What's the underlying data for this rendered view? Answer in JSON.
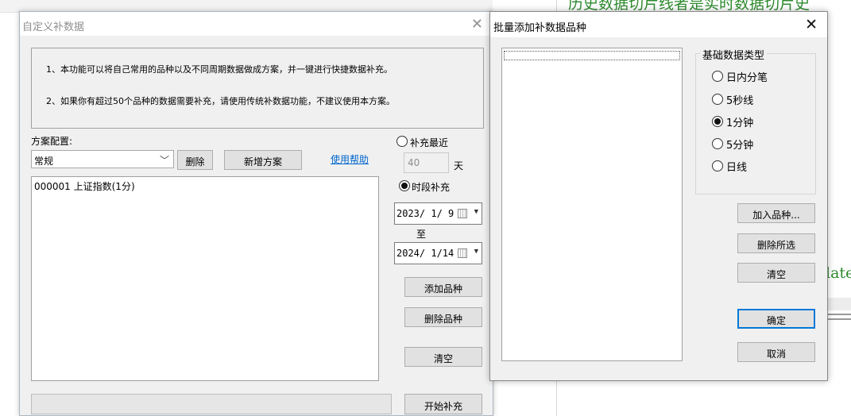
{
  "background": {
    "green_text_top": "历史数据切片线者是实时数据切片史",
    "green_text_mid": "late"
  },
  "dialog_custom": {
    "title": "自定义补数据",
    "info_line1": "1、本功能可以将自己常用的品种以及不同周期数据做成方案，并一键进行快捷数据补充。",
    "info_line2": "2、如果你有超过50个品种的数据需要补充，请使用传统补数据功能，不建议使用本方案。",
    "scheme_label": "方案配置:",
    "scheme_value": "常规",
    "delete_label": "删除",
    "new_scheme_label": "新增方案",
    "help_link": "使用帮助",
    "list_items": [
      "000001 上证指数(1分)"
    ],
    "recent_radio": "补充最近",
    "recent_days": "40",
    "days_unit": "天",
    "period_radio": "时段补充",
    "date_from": "2023/ 1/ 9",
    "date_to_label": "至",
    "date_to": "2024/ 1/14",
    "add_item": "添加品种",
    "delete_item": "删除品种",
    "clear": "清空",
    "start": "开始补充",
    "selected_mode": "period"
  },
  "dialog_batch": {
    "title": "批量添加补数据品种",
    "group_title": "基础数据类型",
    "options": [
      "日内分笔",
      "5秒线",
      "1分钟",
      "5分钟",
      "日线"
    ],
    "selected_option": "1分钟",
    "add_btn": "加入品种...",
    "delete_sel_btn": "删除所选",
    "clear_btn": "清空",
    "ok_btn": "确定",
    "cancel_btn": "取消"
  }
}
